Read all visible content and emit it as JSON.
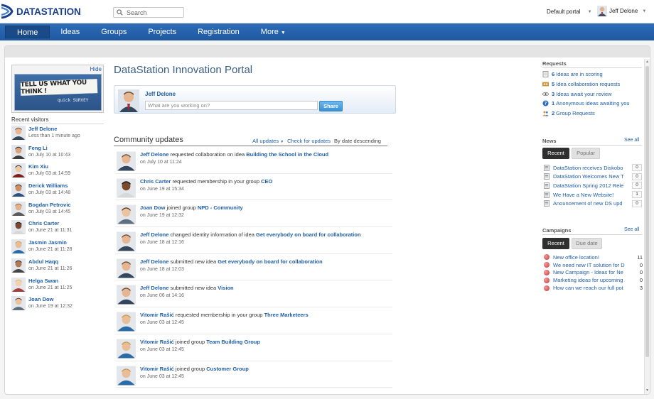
{
  "header": {
    "logo_text": "DATASTATION",
    "search_placeholder": "Search",
    "portal_select": "Default portal",
    "user_name": "Jeff Delone"
  },
  "nav": {
    "items": [
      {
        "label": "Home"
      },
      {
        "label": "Ideas"
      },
      {
        "label": "Groups"
      },
      {
        "label": "Projects"
      },
      {
        "label": "Registration"
      },
      {
        "label": "More"
      }
    ],
    "active": "Home"
  },
  "left": {
    "survey": {
      "hide_label": "Hide",
      "headline": "TELL US WHAT YOU THINK !",
      "sub": "quick SURVEY"
    },
    "recent_visitors_title": "Recent visitors",
    "visitors": [
      {
        "name": "Jeff Delone",
        "time": "Less than 1 minute ago"
      },
      {
        "name": "Feng Li",
        "time": "on July 10 at 10:43"
      },
      {
        "name": "Kim Xiu",
        "time": "on July 03 at 14:59"
      },
      {
        "name": "Derick Williams",
        "time": "on July 03 at 14:48"
      },
      {
        "name": "Bogdan Petrovic",
        "time": "on July 03 at 14:45"
      },
      {
        "name": "Chris Carter",
        "time": "on June 21 at 11:31"
      },
      {
        "name": "Jasmin Jasmin",
        "time": "on June 21 at 11:28"
      },
      {
        "name": "Abdul Haqq",
        "time": "on June 21 at 11:26"
      },
      {
        "name": "Helga Swan",
        "time": "on June 21 at 11:25"
      },
      {
        "name": "Joan Dow",
        "time": "on June 19 at 12:32"
      }
    ]
  },
  "main": {
    "portal_title": "DataStation Innovation Portal",
    "share": {
      "user": "Jeff Delone",
      "placeholder": "What are you working on?",
      "button": "Share"
    },
    "community": {
      "title": "Community updates",
      "filter": "All updates",
      "check": "Check for updates",
      "sort": "By date descending"
    },
    "feed": [
      {
        "actor": "Jeff Delone",
        "action": " requested collaboration on idea ",
        "target": "Building the School in the Cloud",
        "date": "on July 10 at 11:24"
      },
      {
        "actor": "Chris Carter",
        "action": " requested membership in your group ",
        "target": "CEO",
        "date": "on June 19 at 15:34"
      },
      {
        "actor": "Joan Dow",
        "action": " joined group ",
        "target": "NPD - Community",
        "date": "on June 19 at 12:32"
      },
      {
        "actor": "Jeff Delone",
        "action": " changed identity information of idea ",
        "target": "Get everybody on board for collaboration",
        "date": "on June 18 at 12:16"
      },
      {
        "actor": "Jeff Delone",
        "action": " submitted new idea ",
        "target": "Get everybody on board for collaboration",
        "date": "on June 18 at 12:03"
      },
      {
        "actor": "Jeff Delone",
        "action": " submitted new idea ",
        "target": "Vision",
        "date": "on June 06 at 14:16"
      },
      {
        "actor": "Vitomir Rašić",
        "action": " requested membership in your group ",
        "target": "Three Marketeers",
        "date": "on June 03 at 12:45"
      },
      {
        "actor": "Vitomir Rašić",
        "action": " joined group ",
        "target": "Team Building Group",
        "date": "on June 03 at 12:45"
      },
      {
        "actor": "Vitomir Rašić",
        "action": " joined group ",
        "target": "Customer Group",
        "date": "on June 03 at 12:45"
      }
    ]
  },
  "right": {
    "requests": {
      "title": "Requests",
      "items": [
        {
          "count": "6",
          "text": "Ideas are in scoring",
          "icon": "document-icon"
        },
        {
          "count": "5",
          "text": "Idea collaboration requests",
          "icon": "collaboration-icon"
        },
        {
          "count": "3",
          "text": "Ideas await your review",
          "icon": "eye-icon"
        },
        {
          "count": "1",
          "text": "Anonymous ideas awaiting you",
          "icon": "question-icon"
        },
        {
          "count": "2",
          "text": "Group Requests",
          "icon": "group-icon"
        }
      ]
    },
    "news": {
      "title": "News",
      "see_all": "See all",
      "tab_recent": "Recent",
      "tab_popular": "Popular",
      "items": [
        {
          "title": "DataStation receives Diskobo",
          "count": "0"
        },
        {
          "title": "DataStation Welcomes New T",
          "count": "0"
        },
        {
          "title": "DataStation Spring 2012 Rele",
          "count": "0"
        },
        {
          "title": "We Have a New Website!",
          "count": "1"
        },
        {
          "title": "Anouncement of new DS upd",
          "count": "0"
        }
      ]
    },
    "campaigns": {
      "title": "Campaigns",
      "see_all": "See all",
      "tab_recent": "Recent",
      "tab_due": "Due date",
      "items": [
        {
          "title": "New office location!",
          "count": "11"
        },
        {
          "title": "We need new IT solution for D",
          "count": "0"
        },
        {
          "title": "New Campaign - Ideas for Ne",
          "count": "0"
        },
        {
          "title": "Marketing ideas for upcoming",
          "count": "0"
        },
        {
          "title": "How can we reach our full pot",
          "count": "3"
        }
      ]
    }
  },
  "colors": {
    "nav_blue": "#2563ad",
    "link_blue": "#1f5ea8",
    "title_blue": "#3b5f86",
    "share_button": "#4a9de0",
    "campaign_dot": "#d04040"
  }
}
